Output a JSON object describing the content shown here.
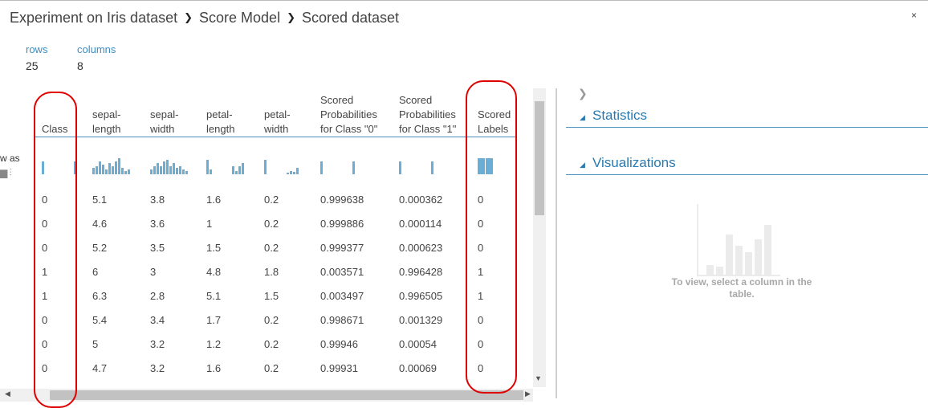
{
  "breadcrumb": [
    "Experiment on Iris dataset",
    "Score Model",
    "Scored dataset"
  ],
  "close_icon": "×",
  "stats": {
    "rows_label": "rows",
    "rows_value": "25",
    "columns_label": "columns",
    "columns_value": "8"
  },
  "stray_text": "w as",
  "table": {
    "columns": [
      "Class",
      "sepal-\nlength",
      "sepal-\nwidth",
      "petal-\nlength",
      "petal-\nwidth",
      "Scored\nProbabilities\nfor Class \"0\"",
      "Scored\nProbabilities\nfor Class \"1\"",
      "Scored\nLabels"
    ],
    "histograms": [
      [
        16,
        0,
        0,
        0,
        0,
        0,
        0,
        0,
        0,
        0,
        16
      ],
      [
        8,
        10,
        16,
        12,
        6,
        14,
        10,
        16,
        20,
        8,
        4,
        6
      ],
      [
        6,
        10,
        14,
        10,
        16,
        18,
        10,
        14,
        8,
        10,
        6,
        4
      ],
      [
        18,
        6,
        0,
        0,
        0,
        0,
        0,
        0,
        10,
        4,
        10,
        14
      ],
      [
        18,
        0,
        0,
        0,
        0,
        0,
        0,
        2,
        4,
        3,
        8
      ],
      [
        16,
        0,
        0,
        0,
        0,
        0,
        0,
        0,
        0,
        0,
        16
      ],
      [
        16,
        0,
        0,
        0,
        0,
        0,
        0,
        0,
        0,
        0,
        16
      ],
      [
        20,
        20
      ]
    ],
    "rows": [
      [
        "0",
        "5.1",
        "3.8",
        "1.6",
        "0.2",
        "0.999638",
        "0.000362",
        "0"
      ],
      [
        "0",
        "4.6",
        "3.6",
        "1",
        "0.2",
        "0.999886",
        "0.000114",
        "0"
      ],
      [
        "0",
        "5.2",
        "3.5",
        "1.5",
        "0.2",
        "0.999377",
        "0.000623",
        "0"
      ],
      [
        "1",
        "6",
        "3",
        "4.8",
        "1.8",
        "0.003571",
        "0.996428",
        "1"
      ],
      [
        "1",
        "6.3",
        "2.8",
        "5.1",
        "1.5",
        "0.003497",
        "0.996505",
        "1"
      ],
      [
        "0",
        "5.4",
        "3.4",
        "1.7",
        "0.2",
        "0.998671",
        "0.001329",
        "0"
      ],
      [
        "0",
        "5",
        "3.2",
        "1.2",
        "0.2",
        "0.99946",
        "0.00054",
        "0"
      ],
      [
        "0",
        "4.7",
        "3.2",
        "1.6",
        "0.2",
        "0.99931",
        "0.00069",
        "0"
      ]
    ]
  },
  "panel": {
    "statistics_label": "Statistics",
    "visualizations_label": "Visualizations",
    "hint": "To view, select a column in the table."
  },
  "colors": {
    "accent": "#2a7ab0",
    "histogram": "#6aaed6",
    "annotation": "#e00000"
  },
  "icons": {
    "breadcrumb_separator": "chevron-right-icon",
    "expand": "chevron-right-icon",
    "section": "triangle-down-icon"
  }
}
